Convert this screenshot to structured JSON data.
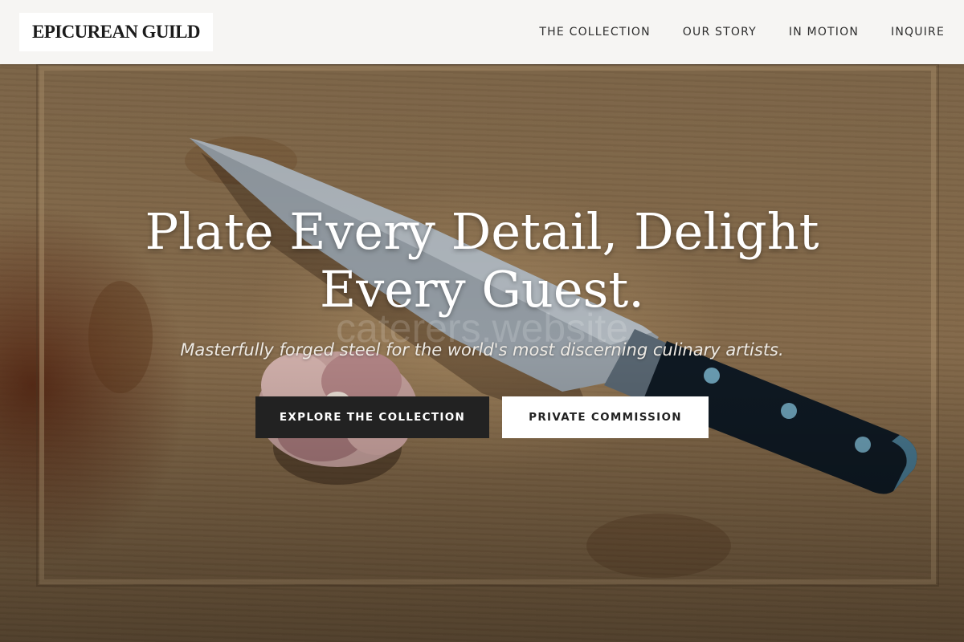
{
  "header": {
    "logo": "EPICUREAN GUILD",
    "nav": [
      {
        "label": "THE COLLECTION"
      },
      {
        "label": "OUR STORY"
      },
      {
        "label": "IN MOTION"
      },
      {
        "label": "INQUIRE"
      }
    ]
  },
  "hero": {
    "headline_line1": "Plate Every Detail, Delight",
    "headline_line2": "Every Guest.",
    "watermark": "caterers.website",
    "subheadline": "Masterfully forged steel for the world's most discerning culinary artists.",
    "primary_button": "EXPLORE THE COLLECTION",
    "secondary_button": "PRIVATE COMMISSION",
    "background_image": "chef-knife-and-garlic-on-cutting-board"
  },
  "colors": {
    "header_bg": "#f6f5f3",
    "primary_button_bg": "#222222",
    "secondary_button_bg": "#ffffff",
    "headline_text": "#ffffff"
  }
}
